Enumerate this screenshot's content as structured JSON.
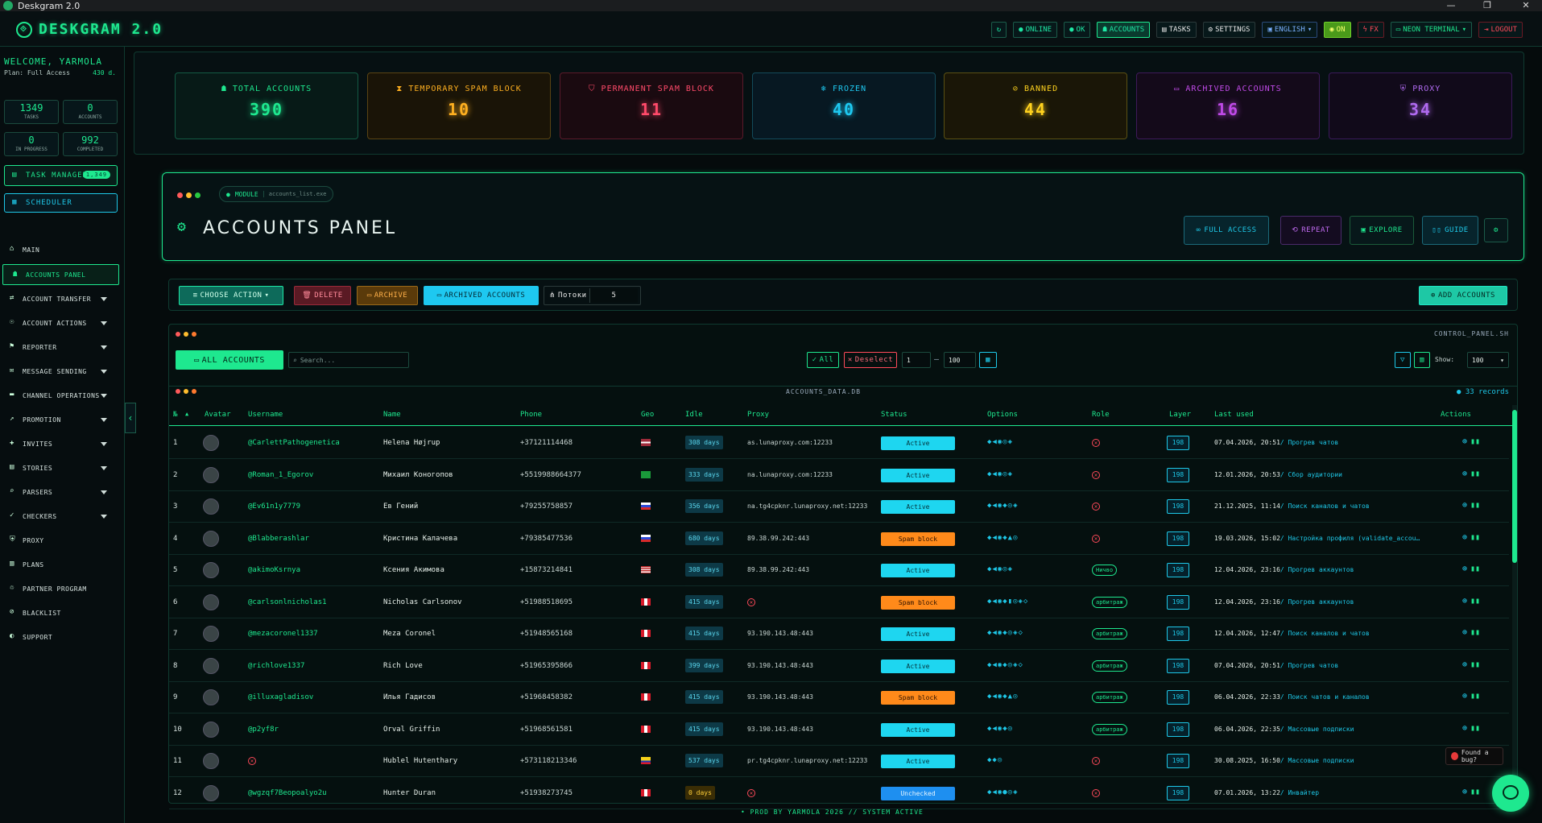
{
  "window": {
    "title": "Deskgram 2.0"
  },
  "brand": {
    "name": "DESKGRAM 2.0"
  },
  "topbar": {
    "online": "ONLINE",
    "ok": "OK",
    "accounts": "ACCOUNTS",
    "tasks": "TASKS",
    "settings": "SETTINGS",
    "language": "ENGLISH",
    "on": "ON",
    "fx": "FX",
    "theme": "NEON TERMINAL",
    "logout": "LOGOUT"
  },
  "sidebar": {
    "welcome": "WELCOME, YARMOLA",
    "plan": "Plan: Full Access",
    "days": "430 d.",
    "stats": [
      {
        "value": "1349",
        "label": "TASKS"
      },
      {
        "value": "0",
        "label": "ACCOUNTS"
      },
      {
        "value": "0",
        "label": "IN PROGRESS"
      },
      {
        "value": "992",
        "label": "COMPLETED"
      }
    ],
    "task_manager": "TASK MANAGER",
    "task_badge": "1,349",
    "scheduler": "SCHEDULER",
    "nav": [
      {
        "label": "MAIN",
        "icon": "home-icon",
        "expand": false
      },
      {
        "label": "ACCOUNTS PANEL",
        "icon": "users-icon",
        "expand": false,
        "active": true
      },
      {
        "label": "ACCOUNT TRANSFER",
        "icon": "user-transfer-icon",
        "expand": true
      },
      {
        "label": "ACCOUNT ACTIONS",
        "icon": "user-actions-icon",
        "expand": true
      },
      {
        "label": "REPORTER",
        "icon": "flag-icon",
        "expand": true
      },
      {
        "label": "MESSAGE SENDING",
        "icon": "message-icon",
        "expand": true
      },
      {
        "label": "CHANNEL OPERATIONS",
        "icon": "channel-icon",
        "expand": true
      },
      {
        "label": "PROMOTION",
        "icon": "chart-icon",
        "expand": true
      },
      {
        "label": "INVITES",
        "icon": "invite-icon",
        "expand": true
      },
      {
        "label": "STORIES",
        "icon": "stories-icon",
        "expand": true
      },
      {
        "label": "PARSERS",
        "icon": "search-icon",
        "expand": true
      },
      {
        "label": "CHECKERS",
        "icon": "check-icon",
        "expand": true
      },
      {
        "label": "PROXY",
        "icon": "shield-icon",
        "expand": false
      },
      {
        "label": "PLANS",
        "icon": "plans-icon",
        "expand": false
      },
      {
        "label": "PARTNER PROGRAM",
        "icon": "partner-icon",
        "expand": false
      },
      {
        "label": "BLACKLIST",
        "icon": "blacklist-icon",
        "expand": false
      },
      {
        "label": "SUPPORT",
        "icon": "headset-icon",
        "expand": false
      }
    ]
  },
  "cards": [
    {
      "label": "TOTAL ACCOUNTS",
      "value": "390",
      "icon": "users-icon",
      "color": "#1ee88f",
      "bg": "#071a17",
      "border": "#135a44"
    },
    {
      "label": "TEMPORARY SPAM BLOCK",
      "value": "10",
      "icon": "hourglass-icon",
      "color": "#ffb020",
      "bg": "#1a1407",
      "border": "#5a4413"
    },
    {
      "label": "PERMANENT SPAM BLOCK",
      "value": "11",
      "icon": "shield-alert-icon",
      "color": "#ff4a6a",
      "bg": "#1a0a10",
      "border": "#5a1a2a"
    },
    {
      "label": "FROZEN",
      "value": "40",
      "icon": "snowflake-icon",
      "color": "#1ec8f0",
      "bg": "#071822",
      "border": "#134a5a"
    },
    {
      "label": "BANNED",
      "value": "44",
      "icon": "ban-icon",
      "color": "#ffd21e",
      "bg": "#1a1607",
      "border": "#5a5013"
    },
    {
      "label": "ARCHIVED ACCOUNTS",
      "value": "16",
      "icon": "archive-icon",
      "color": "#c04ae8",
      "bg": "#140a1a",
      "border": "#3e1a5a"
    },
    {
      "label": "PROXY",
      "value": "34",
      "icon": "shield-icon",
      "color": "#b06af0",
      "bg": "#110a1a",
      "border": "#3a1a5a"
    }
  ],
  "panel": {
    "module": "MODULE",
    "file": "accounts_list.exe",
    "title": "ACCOUNTS PANEL",
    "full_access": "FULL ACCESS",
    "repeat": "REPEAT",
    "explore": "EXPLORE",
    "guide": "GUIDE"
  },
  "actions": {
    "choose": "CHOOSE ACTION",
    "delete": "DELETE",
    "archive": "ARCHIVE",
    "archived": "ARCHIVED ACCOUNTS",
    "threads_label": "Потоки",
    "threads_value": "5",
    "add": "ADD ACCOUNTS"
  },
  "control": {
    "filename": "CONTROL_PANEL.SH",
    "all_accounts": "ALL ACCOUNTS",
    "search_placeholder": "Search...",
    "all": "All",
    "deselect": "Deselect",
    "range_from": "1",
    "range_to": "100",
    "show_label": "Show:",
    "show_value": "100"
  },
  "table": {
    "filename": "ACCOUNTS_DATA.DB",
    "records": "33 records",
    "headers": [
      "№",
      "Avatar",
      "Username",
      "Name",
      "Phone",
      "Geo",
      "Idle",
      "Proxy",
      "Status",
      "Options",
      "Role",
      "Layer",
      "Last used",
      "Actions"
    ],
    "rows": [
      {
        "n": "1",
        "user": "@CarlettPathogenetica",
        "name": "Helena Højrup",
        "phone": "+37121114468",
        "geo": "lv",
        "idle": "308 days",
        "proxy": "as.lunaproxy.com:12233",
        "status": "Active",
        "opts": "◆◀◉◎◈",
        "role": "x",
        "layer": "198",
        "last_date": "07.04.2026, 20:51",
        "last_task": "/ Прогрев чатов"
      },
      {
        "n": "2",
        "user": "@Roman_1_Egorov",
        "name": "Михаил Коногопов",
        "phone": "+5519988664377",
        "geo": "br",
        "idle": "333 days",
        "proxy": "na.lunaproxy.com:12233",
        "status": "Active",
        "opts": "◆◀◉◎◈",
        "role": "x",
        "layer": "198",
        "last_date": "12.01.2026, 20:53",
        "last_task": "/ Сбор аудитории"
      },
      {
        "n": "3",
        "user": "@Ev61n1y7779",
        "name": "Ев Гений",
        "phone": "+79255758857",
        "geo": "ru",
        "idle": "356 days",
        "proxy": "na.tg4cpknr.lunaproxy.net:12233",
        "status": "Active",
        "opts": "◆◀◉◆◎◈",
        "role": "x",
        "layer": "198",
        "last_date": "21.12.2025, 11:14",
        "last_task": "/ Поиск каналов и чатов"
      },
      {
        "n": "4",
        "user": "@Blabberashlar",
        "name": "Кристина Калачева",
        "phone": "+79385477536",
        "geo": "ru",
        "idle": "680 days",
        "proxy": "89.38.99.242:443",
        "status": "Spam block",
        "opts": "◆◀◉◆▲◎",
        "role": "x",
        "layer": "198",
        "last_date": "19.03.2026, 15:02",
        "last_task": "/ Настройка профиля (validate_accou…"
      },
      {
        "n": "5",
        "user": "@akimoKsrnya",
        "name": "Ксения Акимова",
        "phone": "+15873214841",
        "geo": "us",
        "idle": "308 days",
        "proxy": "89.38.99.242:443",
        "status": "Active",
        "opts": "◆◀◉◎◈",
        "role": "Ничво",
        "layer": "198",
        "last_date": "12.04.2026, 23:16",
        "last_task": "/ Прогрев аккаунтов"
      },
      {
        "n": "6",
        "user": "@carlsonlnicholas1",
        "name": "Nicholas Carlsonov",
        "phone": "+51988518695",
        "geo": "pe",
        "idle": "415 days",
        "proxy": "x",
        "status": "Spam block",
        "opts": "◆◀◉◆▮◎◈◇",
        "role": "арбитраж",
        "layer": "198",
        "last_date": "12.04.2026, 23:16",
        "last_task": "/ Прогрев аккаунтов"
      },
      {
        "n": "7",
        "user": "@mezacoronel1337",
        "name": "Meza Coronel",
        "phone": "+51948565168",
        "geo": "pe",
        "idle": "415 days",
        "proxy": "93.190.143.48:443",
        "status": "Active",
        "opts": "◆◀◉◆◎◈◇",
        "role": "арбитраж",
        "layer": "198",
        "last_date": "12.04.2026, 12:47",
        "last_task": "/ Поиск каналов и чатов"
      },
      {
        "n": "8",
        "user": "@richlove1337",
        "name": "Rich Love",
        "phone": "+51965395866",
        "geo": "pe",
        "idle": "399 days",
        "proxy": "93.190.143.48:443",
        "status": "Active",
        "opts": "◆◀◉◆◎◈◇",
        "role": "арбитраж",
        "layer": "198",
        "last_date": "07.04.2026, 20:51",
        "last_task": "/ Прогрев чатов"
      },
      {
        "n": "9",
        "user": "@illuxagladisov",
        "name": "Илья Гадисов",
        "phone": "+51968458382",
        "geo": "pe",
        "idle": "415 days",
        "proxy": "93.190.143.48:443",
        "status": "Spam block",
        "opts": "◆◀◉◆▲◎",
        "role": "арбитраж",
        "layer": "198",
        "last_date": "06.04.2026, 22:33",
        "last_task": "/ Поиск чатов и каналов"
      },
      {
        "n": "10",
        "user": "@p2yf8r",
        "name": "Orval Griffin",
        "phone": "+51968561581",
        "geo": "pe",
        "idle": "415 days",
        "proxy": "93.190.143.48:443",
        "status": "Active",
        "opts": "◆◀◉◆◎",
        "role": "арбитраж",
        "layer": "198",
        "last_date": "06.04.2026, 22:35",
        "last_task": "/ Массовые подписки"
      },
      {
        "n": "11",
        "user": "x",
        "name": "Hublel Hutenthary",
        "phone": "+573118213346",
        "geo": "co",
        "idle": "537 days",
        "proxy": "pr.tg4cpknr.lunaproxy.net:12233",
        "status": "Active",
        "opts": "◆◆◎",
        "role": "x",
        "layer": "198",
        "last_date": "30.08.2025, 16:50",
        "last_task": "/ Массовые подписки"
      },
      {
        "n": "12",
        "user": "@wgzqf7Beopoalyo2u",
        "name": "Hunter Duran",
        "phone": "+51938273745",
        "geo": "pe",
        "idle": "0 days",
        "proxy": "x",
        "status": "Unchecked",
        "opts": "◆◀◉●◎◈",
        "role": "x",
        "layer": "198",
        "last_date": "07.01.2026, 13:22",
        "last_task": "/ Инвайтер"
      }
    ]
  },
  "footer": "• PROD BY YARMOLA 2026  // SYSTEM ACTIVE",
  "bug": "Found a bug?"
}
